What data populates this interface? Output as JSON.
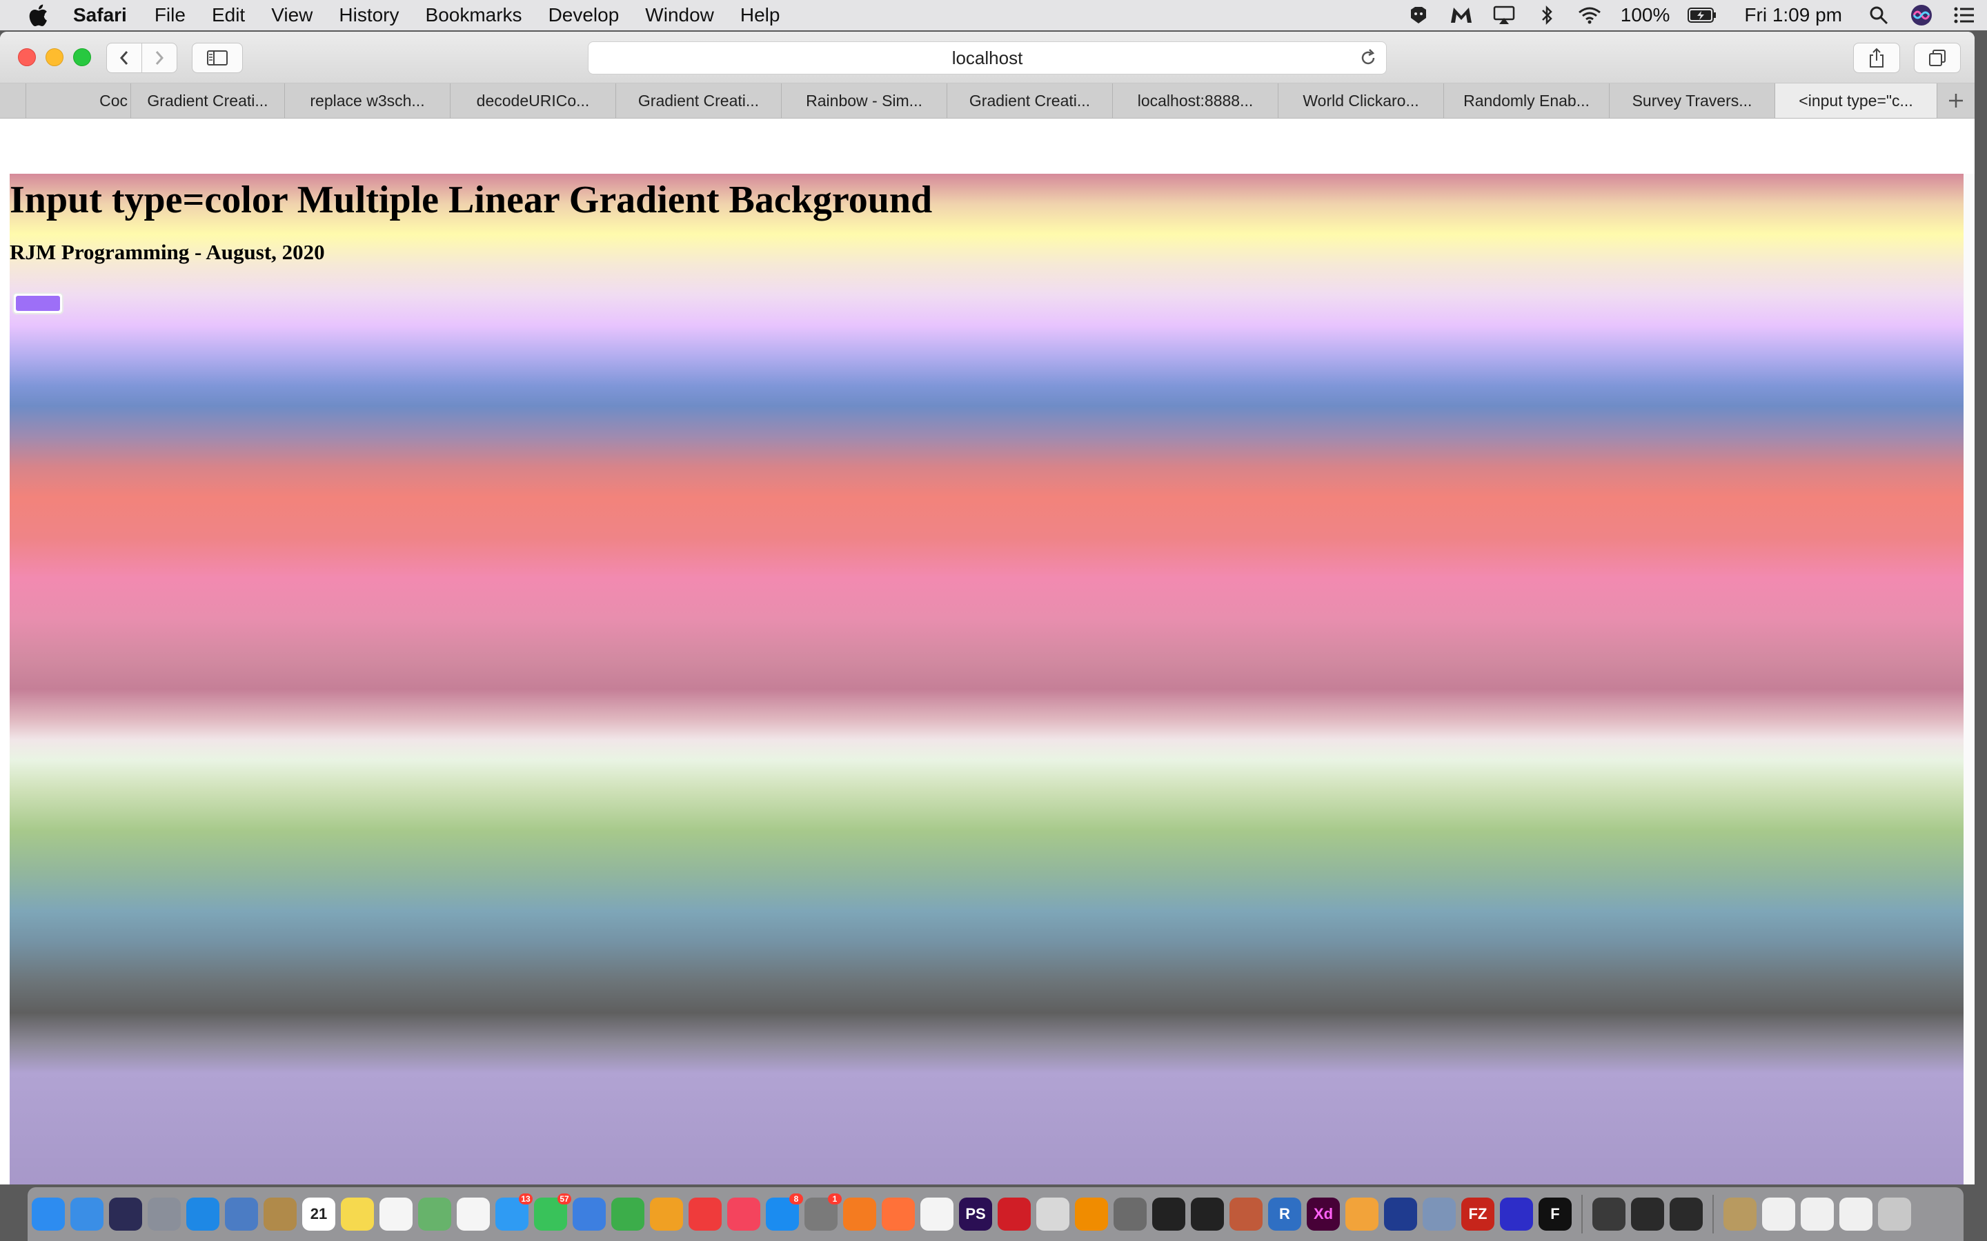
{
  "menubar": {
    "app_name": "Safari",
    "items": [
      "File",
      "Edit",
      "View",
      "History",
      "Bookmarks",
      "Develop",
      "Window",
      "Help"
    ],
    "battery": "100%",
    "clock": "Fri 1:09 pm"
  },
  "toolbar": {
    "url": "localhost"
  },
  "tabs": [
    {
      "label": "Coc",
      "active": false
    },
    {
      "label": "Gradient Creati...",
      "active": false
    },
    {
      "label": "replace w3sch...",
      "active": false
    },
    {
      "label": "decodeURICo...",
      "active": false
    },
    {
      "label": "Gradient Creati...",
      "active": false
    },
    {
      "label": "Rainbow - Sim...",
      "active": false
    },
    {
      "label": "Gradient Creati...",
      "active": false
    },
    {
      "label": "localhost:8888...",
      "active": false
    },
    {
      "label": "World Clickaro...",
      "active": false
    },
    {
      "label": "Randomly Enab...",
      "active": false
    },
    {
      "label": "Survey Travers...",
      "active": false
    },
    {
      "label": "<input type=\"c...",
      "active": true
    }
  ],
  "page": {
    "title": "Input type=color Multiple Linear Gradient Background",
    "subtitle": "RJM Programming - August, 2020",
    "color_value": "#9d6ff7"
  },
  "colors": {
    "accent": "#9d6ff7"
  },
  "dock": {
    "icons": [
      "safari-compass-icon",
      "finder-icon",
      "siri-icon",
      "launchpad-icon",
      "safari-icon",
      "preview-icon",
      "notefile-icon",
      "calendar-icon",
      "notes-icon",
      "reminders-icon",
      "maps-icon",
      "photos-icon",
      "messages-icon",
      "facetime-icon",
      "keynote-icon",
      "numbers-icon",
      "pages-icon",
      "news-icon",
      "music-icon",
      "app-store-icon",
      "system-preferences-icon",
      "avast-icon",
      "firefox-icon",
      "chrome-icon",
      "phpstorm-icon",
      "opera-icon",
      "sequel-icon",
      "vlc-icon",
      "gimp-icon",
      "terminal-icon",
      "inkscape-icon",
      "db-browser-icon",
      "r-icon",
      "xd-icon",
      "pinwheel-icon",
      "flow-icon",
      "image-capture-icon",
      "filezilla-icon",
      "audacity-icon",
      "f-icon",
      "quicktime-icon",
      "console-icon",
      "terminal-2-icon",
      "folder-icon",
      "window-1-icon",
      "window-2-icon",
      "window-3-icon",
      "trash-icon"
    ],
    "calendar_day": "21",
    "calendar_month": "AUG",
    "messages_badge": "13",
    "facetime_badge": "57",
    "appstore_badge": "8",
    "syspref_badge": "1",
    "xd_label": "Xd",
    "ps_label": "PS",
    "r_label": "R",
    "fz_label": "FZ",
    "f_label": "F"
  }
}
